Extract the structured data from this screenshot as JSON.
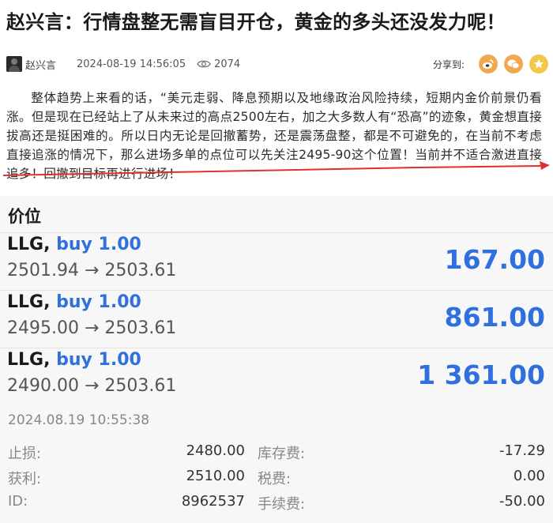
{
  "article": {
    "title": "赵兴言：行情盘整无需盲目开仓，黄金的多头还没发力呢！",
    "author": "赵兴言",
    "date": "2024-08-19 14:56:05",
    "views": "2074",
    "share_label": "分享到:",
    "body": "整体趋势上来看的话，“美元走弱、降息预期以及地缘政治风险持续，短期内金价前景仍看涨。但是现在已经站上了从未来过的高点2500左右，加之大多数人有“恐高”的迹象，黄金想直接拔高还是挺困难的。所以日内无论是回撤蓄势，还是震荡盘整，都是不可避免的，在当前不考虑直接追涨的情况下，那么进场多单的点位可以先关注2495-90这个位置！当前并不适合激进直接追多！回撤到目标再进行进场！"
  },
  "icons": {
    "share": [
      "weibo-icon",
      "wechat-icon",
      "star-icon"
    ],
    "views": "eye-icon"
  },
  "colors": {
    "accent_blue": "#2f6fde",
    "arrow_red": "#e03030",
    "share_orange": "#f0a94f"
  },
  "trades": {
    "heading": "价位",
    "rows": [
      {
        "symbol": "LLG,",
        "side": "buy 1.00",
        "prices": "2501.94 → 2503.61",
        "profit": "167.00"
      },
      {
        "symbol": "LLG,",
        "side": "buy 1.00",
        "prices": "2495.00 → 2503.61",
        "profit": "861.00"
      },
      {
        "symbol": "LLG,",
        "side": "buy 1.00",
        "prices": "2490.00 → 2503.61",
        "profit": "1 361.00"
      }
    ],
    "timestamp": "2024.08.19 10:55:38",
    "details": {
      "stop_loss_label": "止损:",
      "stop_loss": "2480.00",
      "swap_label": "库存费:",
      "swap": "-17.29",
      "take_profit_label": "获利:",
      "take_profit": "2510.00",
      "tax_label": "税费:",
      "tax": "0.00",
      "id_label": "ID:",
      "id": "8962537",
      "commission_label": "手续费:",
      "commission": "-50.00"
    }
  }
}
